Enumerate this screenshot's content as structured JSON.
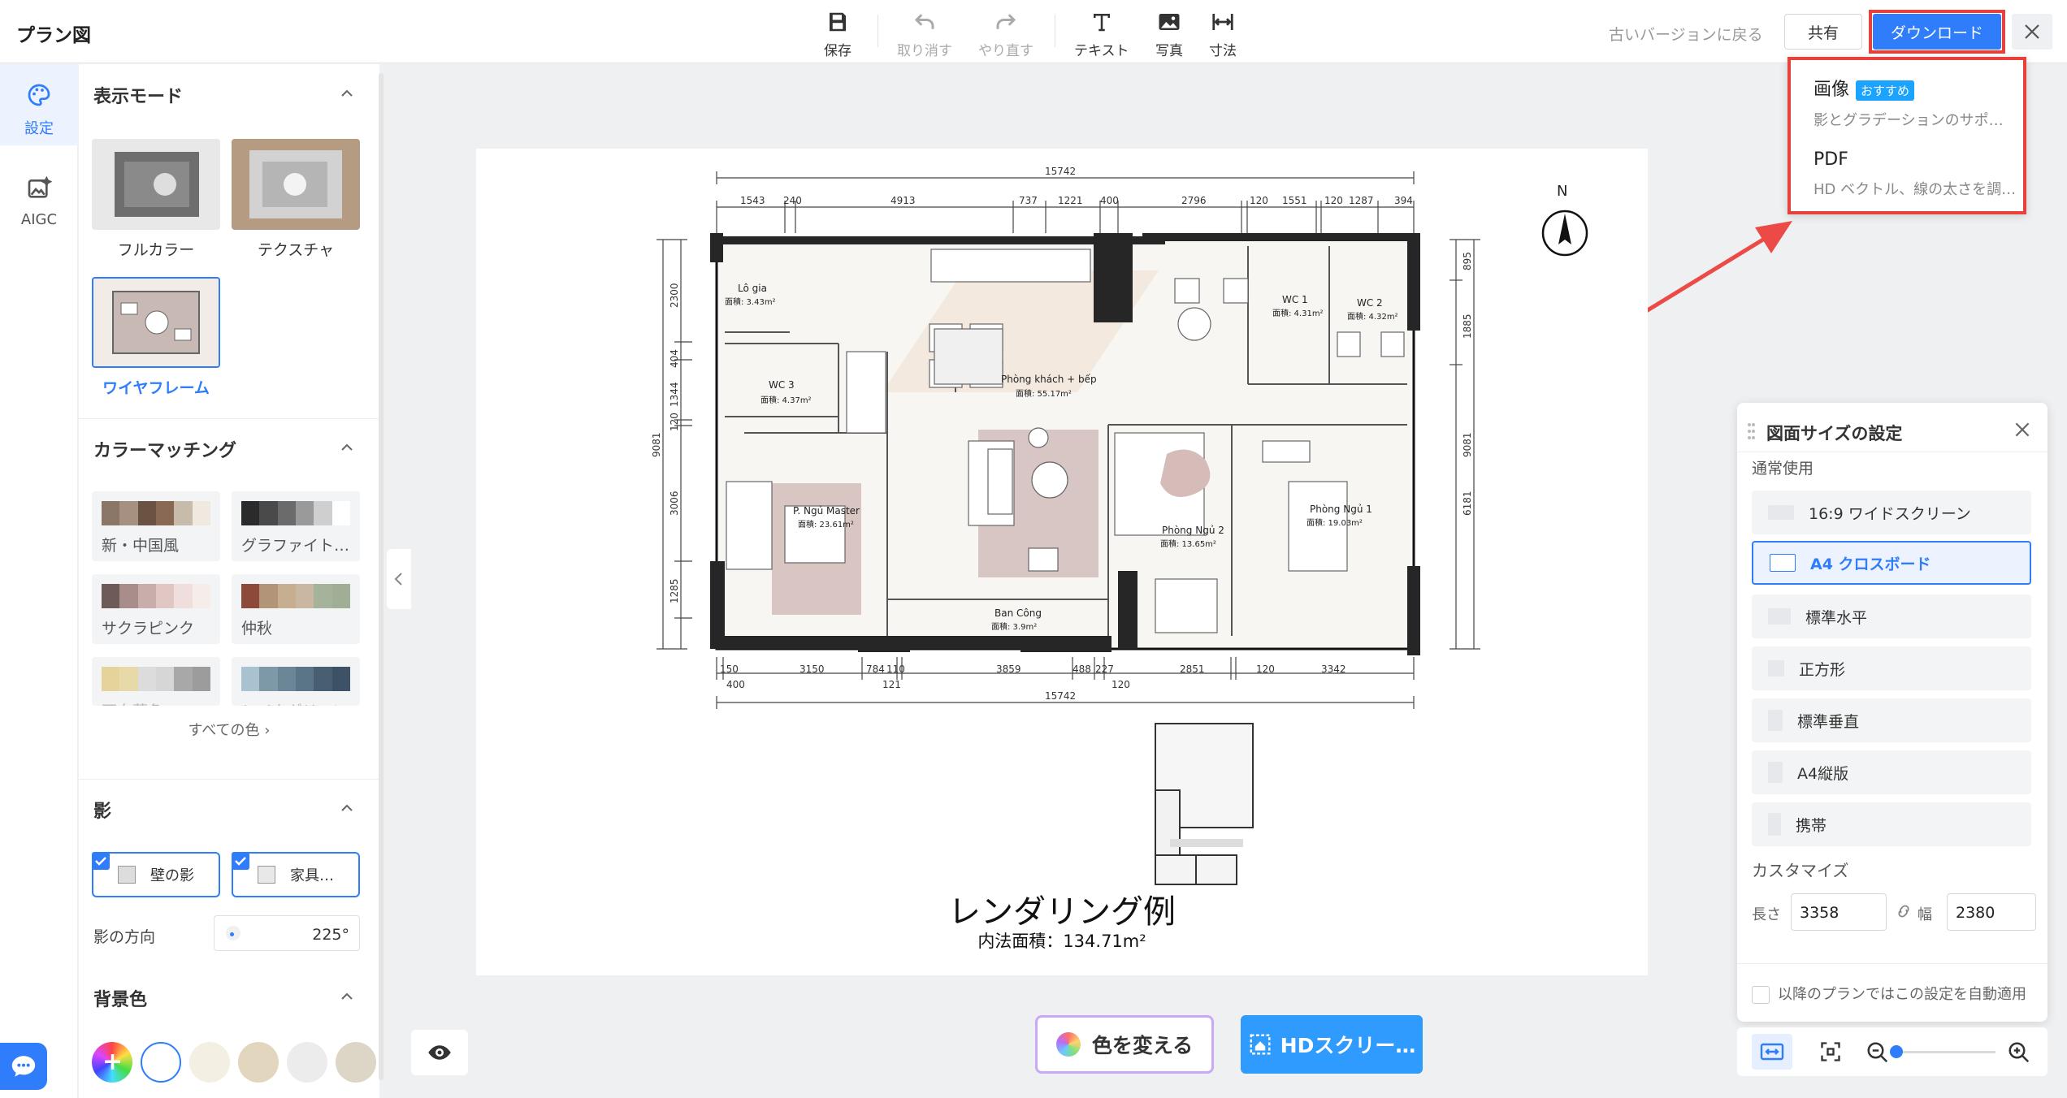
{
  "app": {
    "title": "プラン図"
  },
  "toolbar": {
    "save": "保存",
    "undo": "取り消す",
    "redo": "やり直す",
    "text": "テキスト",
    "photo": "写真",
    "dimension": "寸法",
    "old_version": "古いバージョンに戻る",
    "share": "共有",
    "download": "ダウンロード"
  },
  "download_menu": {
    "image_title": "画像",
    "image_badge": "おすすめ",
    "image_desc": "影とグラデーションのサポ…",
    "pdf_title": "PDF",
    "pdf_desc": "HD ベクトル、線の太さを調…"
  },
  "rail": {
    "settings": "設定",
    "aigc": "AIGC"
  },
  "panel": {
    "display_mode": {
      "title": "表示モード",
      "options": [
        "フルカラー",
        "テクスチャ",
        "ワイヤフレーム"
      ],
      "selected": "ワイヤフレーム"
    },
    "color_matching": {
      "title": "カラーマッチング",
      "palettes": [
        {
          "name": "新・中国風",
          "colors": [
            "#8b7767",
            "#a6907f",
            "#6b5344",
            "#8a6954",
            "#c8bba9",
            "#efe9e0"
          ]
        },
        {
          "name": "グラファイト…",
          "colors": [
            "#2b2b2b",
            "#4a4a4a",
            "#6b6b6b",
            "#9a9a9a",
            "#cfcfcf",
            "#ffffff"
          ]
        },
        {
          "name": "サクラピンク",
          "colors": [
            "#6e5a58",
            "#a88d8a",
            "#c9adaa",
            "#e0c7c3",
            "#efdedb",
            "#f6ecea"
          ]
        },
        {
          "name": "仲秋",
          "colors": [
            "#8d4a3b",
            "#b29478",
            "#c7ae91",
            "#c9b7a1",
            "#a5b39b",
            "#9fae94"
          ]
        },
        {
          "name": "西向暮色",
          "colors": [
            "#e6d39a",
            "#e8d9a8",
            "#dcdcdc",
            "#d6d6d6",
            "#a8a8a8",
            "#9c9c9c"
          ]
        },
        {
          "name": "レイクグリーン",
          "colors": [
            "#a9c2cf",
            "#7d99a8",
            "#6b8797",
            "#5b7588",
            "#485f72",
            "#3d5266"
          ]
        }
      ],
      "all_colors": "すべての色"
    },
    "shadow": {
      "title": "影",
      "wall": "壁の影",
      "furniture": "家具…",
      "direction_label": "影の方向",
      "direction_value": "225°"
    },
    "background": {
      "title": "背景色",
      "colors": [
        "#ffffff",
        "#f3efe2",
        "#e3d6bf",
        "#ececec",
        "#ddd6c6"
      ]
    }
  },
  "canvas": {
    "render_title": "レンダリング例",
    "area": "内法面積：134.71m²",
    "north": "N",
    "dims_top": {
      "total": "15742",
      "parts": [
        "1543",
        "240",
        "4913",
        "737",
        "1221",
        "400",
        "2796",
        "120",
        "1551",
        "120",
        "1287",
        "394"
      ]
    },
    "dims_bottom": {
      "total": "15742",
      "parts": [
        "150",
        "3150",
        "784",
        "110",
        "3859",
        "488",
        "227",
        "2851",
        "120",
        "3342"
      ],
      "sub": [
        "400",
        "121",
        "120"
      ]
    },
    "dims_left": [
      "2300",
      "404",
      "1344",
      "120",
      "3006",
      "1285",
      "9081"
    ],
    "dims_right": [
      "895",
      "1885",
      "9081",
      "6181"
    ],
    "rooms": [
      {
        "name": "Lô gia",
        "area": "面積: 3.43m²"
      },
      {
        "name": "WC 3",
        "area": "面積: 4.37m²"
      },
      {
        "name": "Phòng khách + bếp",
        "area": "面積: 55.17m²"
      },
      {
        "name": "WC 1",
        "area": "面積: 4.31m²"
      },
      {
        "name": "WC 2",
        "area": "面積: 4.32m²"
      },
      {
        "name": "P. Ngủ Master",
        "area": "面積: 23.61m²"
      },
      {
        "name": "Phòng Ngủ 2",
        "area": "面積: 13.65m²"
      },
      {
        "name": "Phòng Ngủ 1",
        "area": "面積: 19.03m²"
      },
      {
        "name": "Ban Công",
        "area": "面積: 3.9m²"
      }
    ]
  },
  "bottom": {
    "change_color": "色を変える",
    "hd_screen": "HDスクリー…"
  },
  "size_panel": {
    "title": "図面サイズの設定",
    "common": "通常使用",
    "options": [
      "16:9 ワイドスクリーン",
      "A4 クロスボード",
      "標準水平",
      "正方形",
      "標準垂直",
      "A4縦版",
      "携帯"
    ],
    "selected": "A4 クロスボード",
    "custom": "カスタマイズ",
    "length_label": "長さ",
    "length": "3358",
    "width_label": "幅",
    "width": "2380",
    "auto_apply": "以降のプランではこの設定を自動適用"
  }
}
